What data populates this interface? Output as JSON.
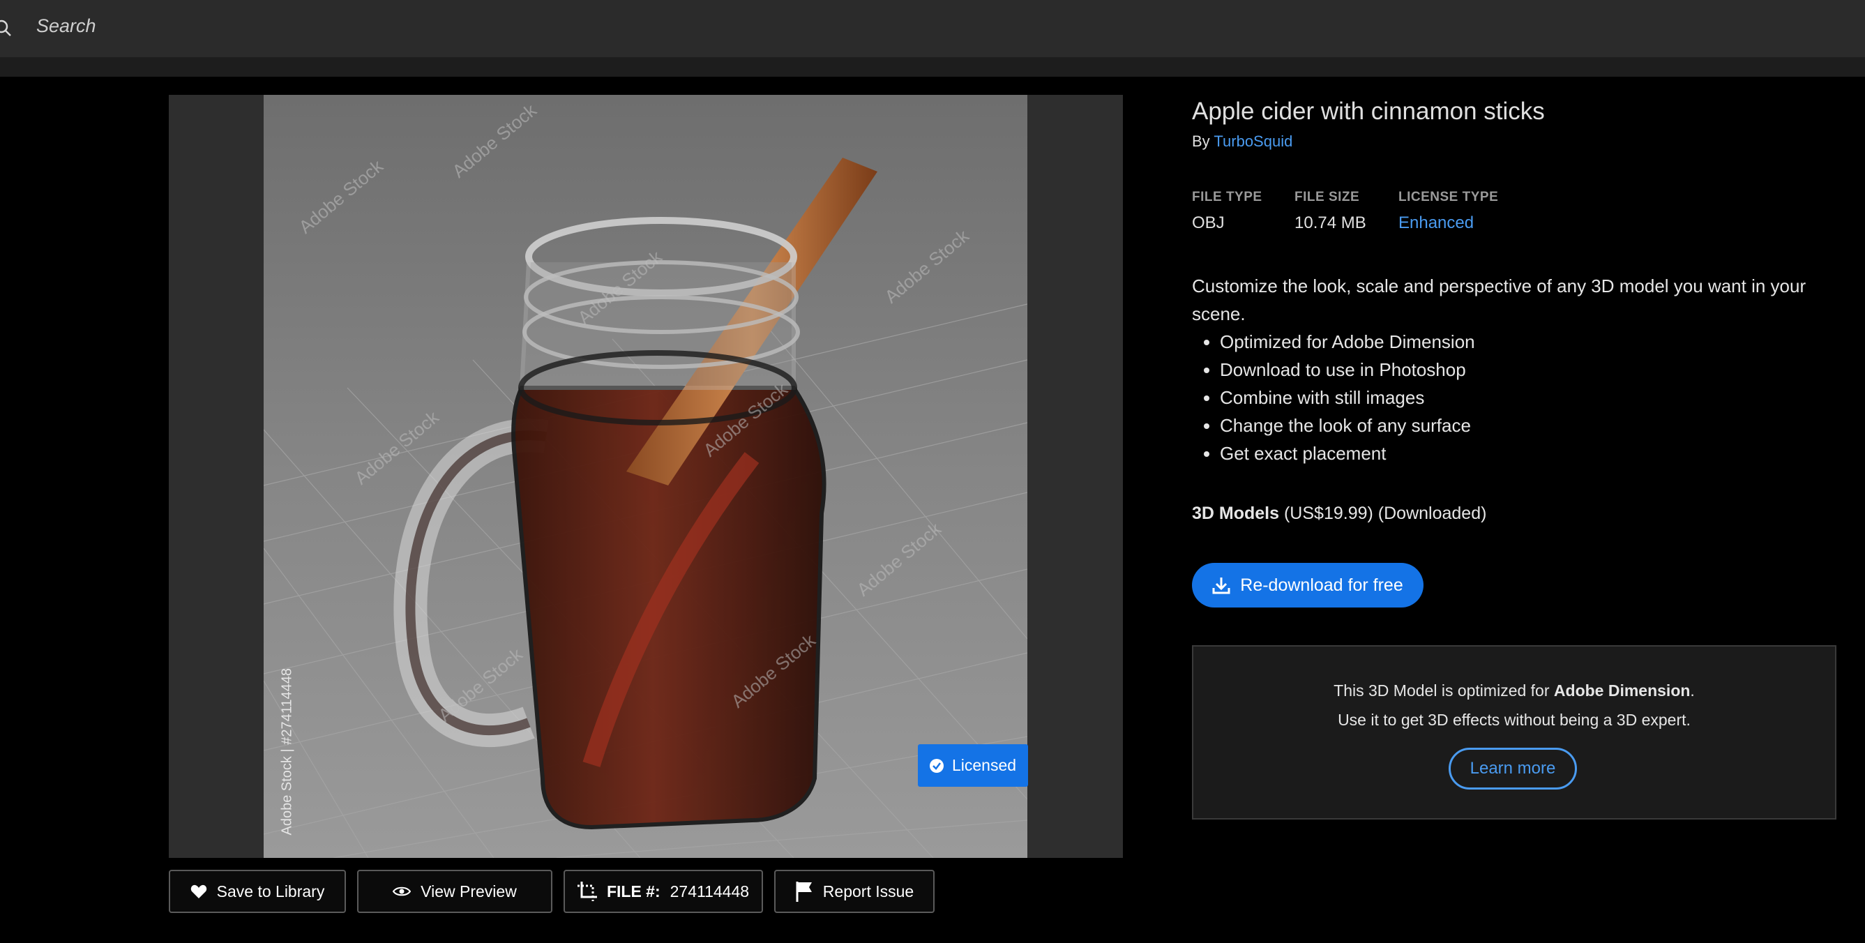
{
  "search": {
    "placeholder": "Search",
    "icon": "search-icon"
  },
  "preview": {
    "watermark": "Adobe Stock",
    "stock_id": "Adobe Stock | #274114448",
    "badge_label": "Licensed",
    "badge_color": "#1473e6"
  },
  "actions": {
    "save_label": "Save to Library",
    "view_label": "View Preview",
    "file_label": "FILE #:",
    "file_number": "274114448",
    "report_label": "Report Issue"
  },
  "asset": {
    "title": "Apple cider with cinnamon sticks",
    "by_prefix": "By",
    "author": "TurboSquid",
    "meta": [
      {
        "label": "FILE TYPE",
        "value": "OBJ"
      },
      {
        "label": "FILE SIZE",
        "value": "10.74 MB"
      },
      {
        "label": "LICENSE TYPE",
        "value": "Enhanced"
      }
    ],
    "description": "Customize the look, scale and perspective of any 3D model you want in your scene.",
    "features": [
      "Optimized for Adobe Dimension",
      "Download to use in Photoshop",
      "Combine with still images",
      "Change the look of any surface",
      "Get exact placement"
    ],
    "pricing": {
      "category": "3D Models",
      "price": "(US$19.99)",
      "status": "(Downloaded)"
    },
    "redownload_label": "Re-download for free"
  },
  "promo": {
    "line1_prefix": "This 3D Model is optimized for ",
    "line1_bold": "Adobe Dimension",
    "line1_suffix": ".",
    "line2": "Use it to get 3D effects without being a 3D expert.",
    "learn_more": "Learn more"
  },
  "colors": {
    "accent": "#1473e6",
    "link": "#4a9bf0",
    "background": "#000000"
  }
}
